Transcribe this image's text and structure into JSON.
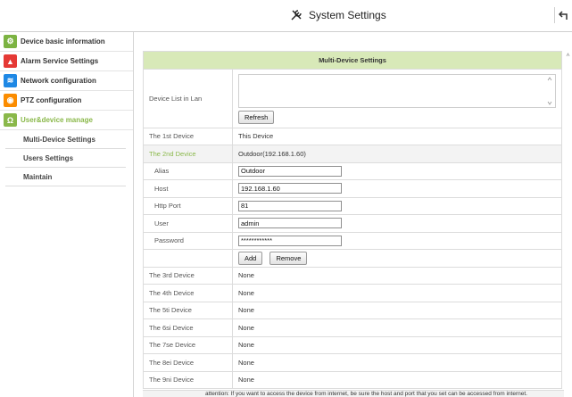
{
  "header": {
    "title": "System Settings"
  },
  "sidebar": {
    "items": [
      {
        "label": "Device basic information",
        "color": "#7cb342",
        "glyph": "⚙"
      },
      {
        "label": "Alarm Service Settings",
        "color": "#e53935",
        "glyph": "🔔"
      },
      {
        "label": "Network configuration",
        "color": "#1e88e5",
        "glyph": "≋"
      },
      {
        "label": "PTZ configuration",
        "color": "#fb8c00",
        "glyph": "◉"
      },
      {
        "label": "User&device manage",
        "color": "#8ab84a",
        "glyph": "Ω"
      }
    ],
    "subitems": [
      "Multi-Device Settings",
      "Users Settings",
      "Maintain"
    ]
  },
  "panel": {
    "title": "Multi-Device Settings",
    "lan_label": "Device List in Lan",
    "refresh": "Refresh",
    "first_label": "The 1st Device",
    "first_value": "This Device",
    "second_label": "The 2nd Device",
    "second_value": "Outdoor(192.168.1.60)",
    "alias_label": "Alias",
    "alias_value": "Outdoor",
    "host_label": "Host",
    "host_value": "192.168.1.60",
    "port_label": "Http Port",
    "port_value": "81",
    "user_label": "User",
    "user_value": "admin",
    "password_label": "Password",
    "password_value": "************",
    "add": "Add",
    "remove": "Remove",
    "devices": [
      {
        "label": "The 3rd Device",
        "value": "None"
      },
      {
        "label": "The 4th Device",
        "value": "None"
      },
      {
        "label": "The 5ti Device",
        "value": "None"
      },
      {
        "label": "The 6si Device",
        "value": "None"
      },
      {
        "label": "The 7se Device",
        "value": "None"
      },
      {
        "label": "The 8ei Device",
        "value": "None"
      },
      {
        "label": "The 9ni Device",
        "value": "None"
      }
    ],
    "attention": "attention: If you want to access the device from internet, be sure the host and port that you set can be accessed from internet."
  }
}
